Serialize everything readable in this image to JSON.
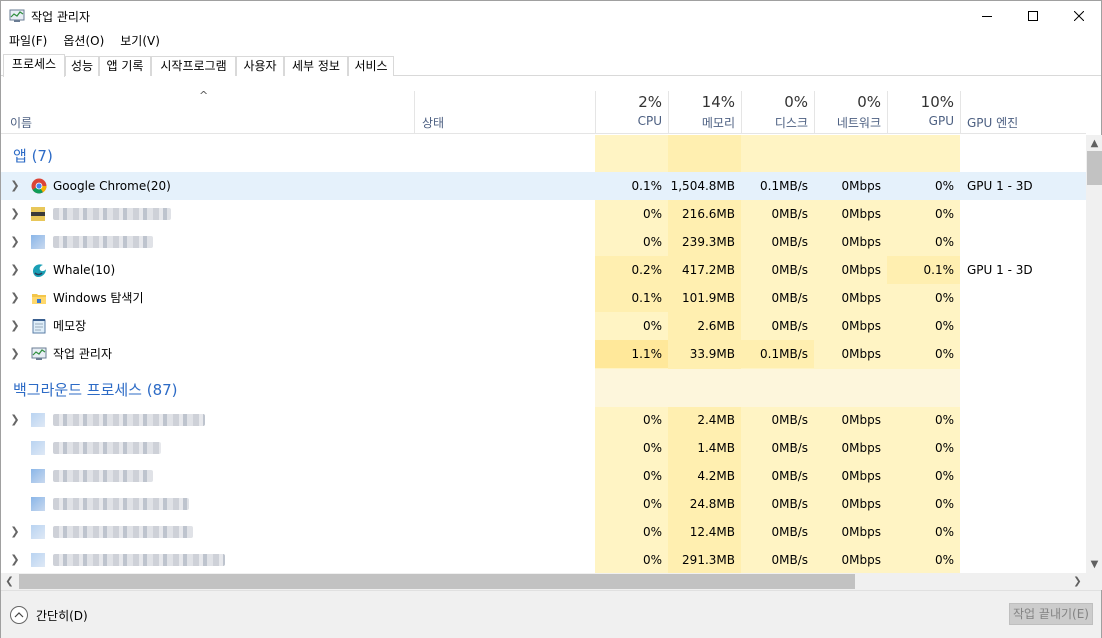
{
  "window": {
    "title": "작업 관리자"
  },
  "menu": [
    "파일(F)",
    "옵션(O)",
    "보기(V)"
  ],
  "tabs": [
    "프로세스",
    "성능",
    "앱 기록",
    "시작프로그램",
    "사용자",
    "세부 정보",
    "서비스"
  ],
  "header": {
    "sort_indicator": "^",
    "name": "이름",
    "status": "상태",
    "cpu_pct": "2%",
    "cpu": "CPU",
    "mem_pct": "14%",
    "mem": "메모리",
    "disk_pct": "0%",
    "disk": "디스크",
    "net_pct": "0%",
    "net": "네트워크",
    "gpu_pct": "10%",
    "gpu": "GPU",
    "gpu_engine": "GPU 엔진"
  },
  "groups": {
    "apps": "앱 (7)",
    "background": "백그라운드 프로세스 (87)"
  },
  "app_rows": [
    {
      "name": "Google Chrome(20)",
      "icon": "chrome-icon",
      "cpu": "0.1%",
      "mem": "1,504.8MB",
      "disk": "0.1MB/s",
      "net": "0Mbps",
      "gpu": "0%",
      "engine": "GPU 1 - 3D"
    },
    {
      "name": "",
      "icon": "blurred-icon",
      "cpu": "0%",
      "mem": "216.6MB",
      "disk": "0MB/s",
      "net": "0Mbps",
      "gpu": "0%",
      "engine": ""
    },
    {
      "name": "",
      "icon": "blurred-icon",
      "cpu": "0%",
      "mem": "239.3MB",
      "disk": "0MB/s",
      "net": "0Mbps",
      "gpu": "0%",
      "engine": ""
    },
    {
      "name": "Whale(10)",
      "icon": "whale-icon",
      "cpu": "0.2%",
      "mem": "417.2MB",
      "disk": "0MB/s",
      "net": "0Mbps",
      "gpu": "0.1%",
      "engine": "GPU 1 - 3D"
    },
    {
      "name": "Windows 탐색기",
      "icon": "folder-icon",
      "cpu": "0.1%",
      "mem": "101.9MB",
      "disk": "0MB/s",
      "net": "0Mbps",
      "gpu": "0%",
      "engine": ""
    },
    {
      "name": "메모장",
      "icon": "notepad-icon",
      "cpu": "0%",
      "mem": "2.6MB",
      "disk": "0MB/s",
      "net": "0Mbps",
      "gpu": "0%",
      "engine": ""
    },
    {
      "name": "작업 관리자",
      "icon": "task-manager-icon",
      "cpu": "1.1%",
      "mem": "33.9MB",
      "disk": "0.1MB/s",
      "net": "0Mbps",
      "gpu": "0%",
      "engine": ""
    }
  ],
  "bg_rows": [
    {
      "cpu": "0%",
      "mem": "2.4MB",
      "disk": "0MB/s",
      "net": "0Mbps",
      "gpu": "0%"
    },
    {
      "cpu": "0%",
      "mem": "1.4MB",
      "disk": "0MB/s",
      "net": "0Mbps",
      "gpu": "0%"
    },
    {
      "cpu": "0%",
      "mem": "4.2MB",
      "disk": "0MB/s",
      "net": "0Mbps",
      "gpu": "0%"
    },
    {
      "cpu": "0%",
      "mem": "24.8MB",
      "disk": "0MB/s",
      "net": "0Mbps",
      "gpu": "0%"
    },
    {
      "cpu": "0%",
      "mem": "12.4MB",
      "disk": "0MB/s",
      "net": "0Mbps",
      "gpu": "0%"
    },
    {
      "cpu": "0%",
      "mem": "291.3MB",
      "disk": "0MB/s",
      "net": "0Mbps",
      "gpu": "0%"
    }
  ],
  "footer": {
    "fewer_details": "간단히(D)",
    "end_task": "작업 끝내기(E)"
  }
}
